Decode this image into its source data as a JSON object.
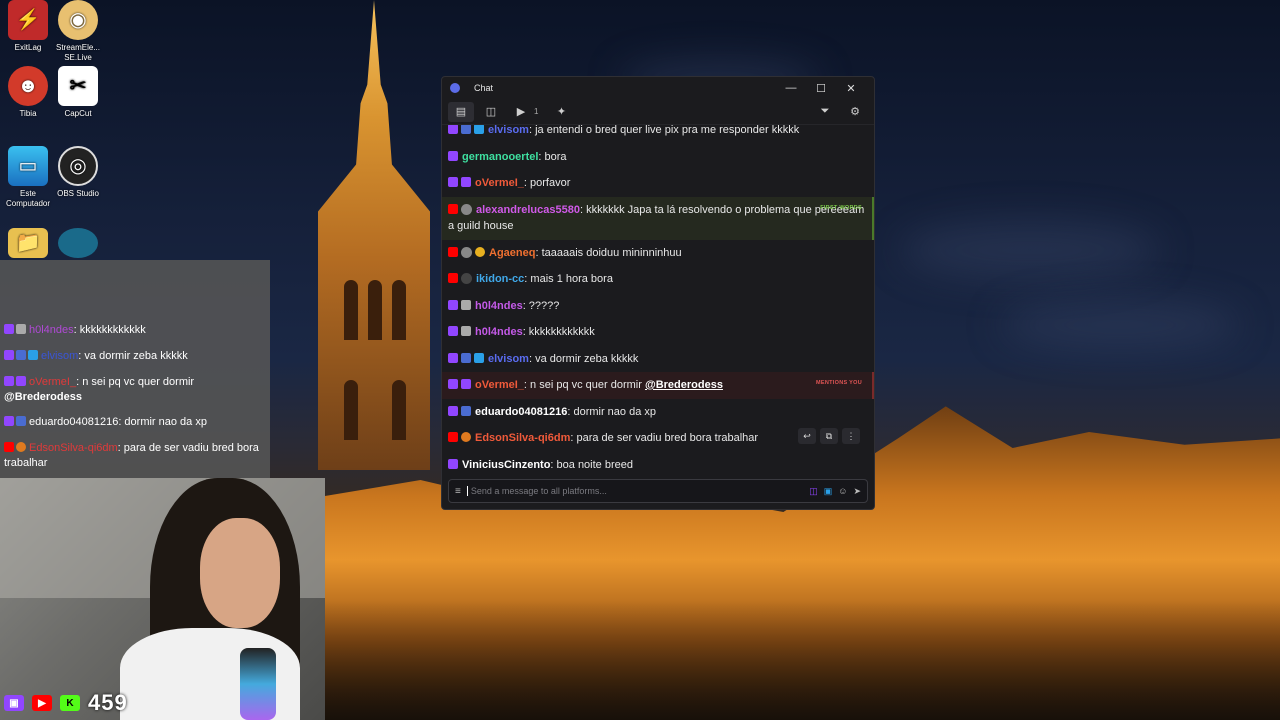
{
  "desktop": {
    "icons": [
      {
        "label": "ExitLag"
      },
      {
        "label": "StreamEle...\nSE.Live"
      },
      {
        "label": "Tibia"
      },
      {
        "label": "CapCut"
      },
      {
        "label": "Este\nComputador"
      },
      {
        "label": "OBS Studio"
      }
    ]
  },
  "overlay_chat": {
    "messages": [
      {
        "user": "h0l4ndes",
        "color": "#b04ad6",
        "text": ": kkkkkkkkkkkk"
      },
      {
        "user": "elvisom",
        "color": "#3a55d6",
        "text": ": va dormir zeba kkkkk"
      },
      {
        "user": "oVermeI_",
        "color": "#e03a3a",
        "text": ": n sei pq vc quer dormir ",
        "mention": "@Brederodess"
      },
      {
        "user": "eduardo04081216",
        "color": "#ffffff",
        "text": ": dormir nao da xp"
      },
      {
        "user": "EdsonSilva-qi6dm",
        "color": "#e03a3a",
        "text": ": para de ser vadiu bred bora trabalhar"
      }
    ]
  },
  "viewer_bar": {
    "count": "459"
  },
  "chat_window": {
    "title": "Chat",
    "toolbar": {
      "video_count": "1"
    },
    "messages": [
      {
        "user": "elvisom",
        "color": "#5a6cf0",
        "text": ": ja entendi o bred quer live pix pra me responder kkkkk",
        "tag": ""
      },
      {
        "user": "germanooertel",
        "color": "#3ee0a0",
        "text": ": bora",
        "tag": ""
      },
      {
        "user": "oVermeI_",
        "color": "#f05a3a",
        "text": ": porfavor",
        "tag": ""
      },
      {
        "user": "alexandrelucas5580",
        "color": "#d05ae8",
        "text": ": kkkkkkk Japa ta lá resolvendo o problema que pereeeam a guild house",
        "tag": "FIRST WORDS"
      },
      {
        "user": "Agaeneq",
        "color": "#f07030",
        "text": ": taaaaais doiduu mininninhuu",
        "tag": ""
      },
      {
        "user": "ikidon-cc",
        "color": "#40a8e8",
        "text": ": mais 1 hora bora",
        "tag": ""
      },
      {
        "user": "h0l4ndes",
        "color": "#c45ae8",
        "text": ": ?????",
        "tag": ""
      },
      {
        "user": "h0l4ndes",
        "color": "#c45ae8",
        "text": ": kkkkkkkkkkkk",
        "tag": ""
      },
      {
        "user": "elvisom",
        "color": "#5a6cf0",
        "text": ": va dormir zeba kkkkk",
        "tag": ""
      },
      {
        "user": "oVermeI_",
        "color": "#f05a3a",
        "text": ": n sei pq vc quer dormir ",
        "mention": "@Brederodess",
        "tag": "MENTIONS YOU"
      },
      {
        "user": "eduardo04081216",
        "color": "#ffffff",
        "text": ": dormir nao da xp",
        "tag": ""
      },
      {
        "user": "EdsonSilva-qi6dm",
        "color": "#f05a3a",
        "text": ": para de ser vadiu bred bora trabalhar",
        "tag": ""
      },
      {
        "user": "ViniciusCinzento",
        "color": "#ffffff",
        "text": ": boa noite breed",
        "tag": ""
      }
    ],
    "input": {
      "placeholder": "Send a message to all platforms..."
    }
  }
}
